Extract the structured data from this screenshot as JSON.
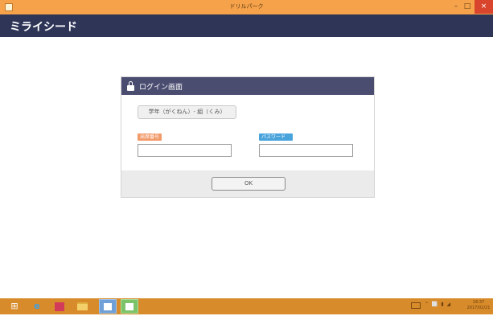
{
  "window": {
    "title": "ドリルパーク",
    "minimize_symbol": "–",
    "maximize_symbol": "□",
    "close_symbol": "×"
  },
  "app": {
    "logo_text": "ミライシード"
  },
  "login": {
    "title": "ログイン画面",
    "grade_button_label": "学年（がくねん）- 組（くみ）",
    "student_number_label": "出席番号",
    "student_number_value": "",
    "password_label": "パスワード",
    "password_value": "",
    "ok_label": "OK"
  },
  "taskbar": {
    "items": [
      "start-icon",
      "internet-explorer-icon",
      "store-icon",
      "file-explorer-icon",
      "app-icon",
      "drill-park-app-icon"
    ],
    "tray_text": "⌃ ⬜ ▮ ◢",
    "clock_time": "18:37",
    "clock_date": "2017/02/21"
  },
  "colors": {
    "titlebar": "#f5a24a",
    "app_header": "#2e3557",
    "dialog_header": "#4a4c70",
    "student_number_tag": "#f29a6a",
    "password_tag": "#4aa4dc",
    "taskbar": "#d88b2a"
  }
}
